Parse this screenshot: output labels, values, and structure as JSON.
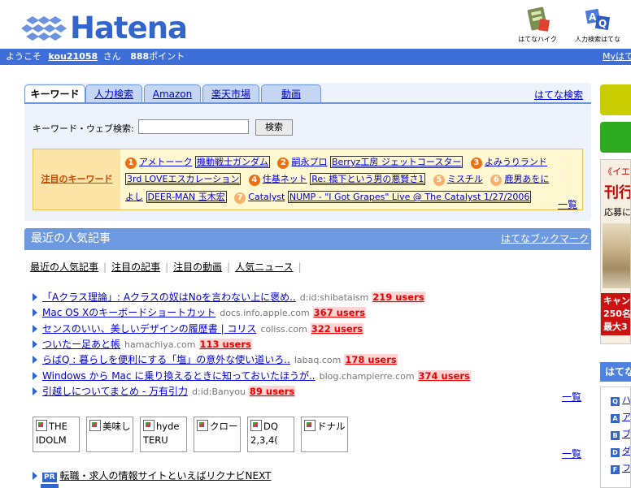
{
  "header": {
    "logo_text": "Hatena",
    "icons": [
      {
        "label": "はてなハイク",
        "icon": "haiku-icon"
      },
      {
        "label": "人力検索はてな",
        "icon": "question-icon"
      }
    ]
  },
  "userbar": {
    "welcome": "ようこそ",
    "username": "kou21058",
    "san": "さん",
    "points": "888",
    "points_label": "ポイント",
    "my_link": "Myはて"
  },
  "search": {
    "tabs": [
      {
        "label": "キーワード",
        "active": true
      },
      {
        "label": "人力検索",
        "active": false
      },
      {
        "label": "Amazon",
        "active": false
      },
      {
        "label": "楽天市場",
        "active": false
      },
      {
        "label": "動画",
        "active": false
      }
    ],
    "hatena_search": "はてな検索",
    "field_label": "キーワード・ウェブ検索:",
    "field_value": "",
    "button": "検索"
  },
  "attention": {
    "label": "注目のキーワード",
    "line1": [
      {
        "n": "1",
        "items": [
          "アメトーーク",
          "機動戦士ガンダム"
        ]
      },
      {
        "n": "2",
        "items": [
          "嗣永プロ",
          "Berryz工房 ジェットコースター"
        ]
      },
      {
        "n": "3",
        "items": [
          "よみうりランド"
        ]
      }
    ],
    "line2": [
      {
        "items": [
          "3rd LOVEエスカレーション"
        ]
      },
      {
        "n": "4",
        "items": [
          "住基ネット",
          "Re: 橋下という男の悪賢さ1"
        ]
      },
      {
        "n": "5",
        "items": [
          "ミスチル"
        ]
      },
      {
        "n": "6",
        "items": [
          "鹿男あをに"
        ]
      }
    ],
    "line3": [
      {
        "items": [
          "よし",
          "DEER-MAN 玉木宏"
        ]
      },
      {
        "n": "7",
        "items": [
          "Catalyst",
          "NUMP - \"I Got Grapes\" Live @ The Catalyst 1/27/2006"
        ]
      }
    ],
    "more": "一覧"
  },
  "popular": {
    "title": "最近の人気記事",
    "bookmark_link": "はてなブックマーク",
    "subnav": [
      "最近の人気記事",
      "注目の記事",
      "注目の動画",
      "人気ニュース"
    ],
    "entries": [
      {
        "title": "「Aクラス理論」: Aクラスの奴はNoを言わない上に褒め..",
        "source": "d:id:shibataism",
        "users": "219 users"
      },
      {
        "title": "Mac OS Xのキーボードショートカット",
        "source": "docs.info.apple.com",
        "users": "367 users"
      },
      {
        "title": "センスのいい、美しいデザインの履歴書 | コリス",
        "source": "coliss.com",
        "users": "322 users"
      },
      {
        "title": "ついたー足あと帳",
        "source": "hamachiya.com",
        "users": "113 users"
      },
      {
        "title": "らばQ : 暮らしを便利にする「塩」の意外な使い道いろ..",
        "source": "labaq.com",
        "users": "178 users"
      },
      {
        "title": "Windows から Mac に乗り換えるときに知っておいたほうが..",
        "source": "blog.champierre.com",
        "users": "374 users"
      },
      {
        "title": "引越しについてまとめ - 万有引力",
        "source": "d:id:Banyou",
        "users": "89 users"
      }
    ],
    "more": "一覧",
    "thumbs": [
      "THE IDOLM",
      "美味し",
      "hyde TERU",
      "クロー",
      "DQ 2,3,4(",
      "ドナル"
    ],
    "thumbs_more": "一覧"
  },
  "pr": {
    "badge": "PR",
    "text": "転職・求人の情報サイトといえばリクナビNEXT"
  },
  "right": {
    "ad": {
      "line1": "《イエに",
      "line2": "刊行",
      "line3": "応募に",
      "band1": "キャン",
      "band2": "250名",
      "band3": "最大3"
    },
    "section_title": "はてな",
    "items": [
      {
        "letter": "Q",
        "text": "ハ"
      },
      {
        "letter": "A",
        "text": "ア"
      },
      {
        "letter": "B",
        "text": "ブ"
      },
      {
        "letter": "D",
        "text": "ダ"
      },
      {
        "letter": "F",
        "text": "フ"
      }
    ]
  },
  "colors": {
    "brand": "#3366cc",
    "userbar": "#3e6fd9",
    "section_head": "#6d99e0",
    "users": "#ee0000"
  }
}
